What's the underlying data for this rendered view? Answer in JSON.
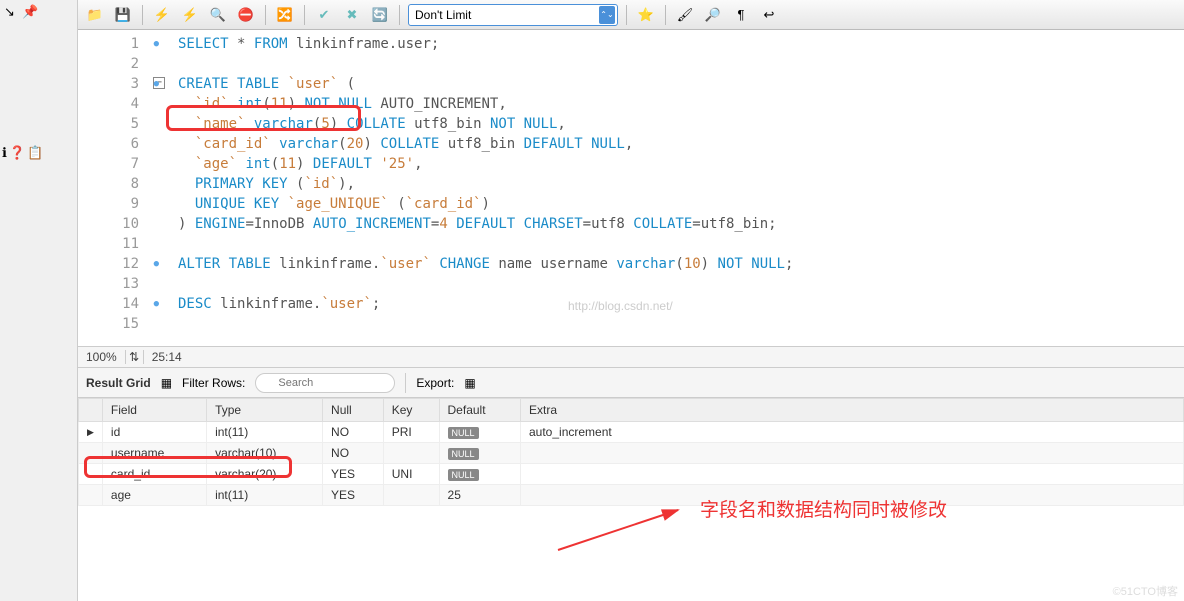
{
  "toolbar": {
    "limit_label": "Don't Limit"
  },
  "editor": {
    "lines": [
      "SELECT * FROM linkinframe.user;",
      "",
      "CREATE TABLE `user` (",
      "  `id` int(11) NOT NULL AUTO_INCREMENT,",
      "  `name` varchar(5) COLLATE utf8_bin NOT NULL,",
      "  `card_id` varchar(20) COLLATE utf8_bin DEFAULT NULL,",
      "  `age` int(11) DEFAULT '25',",
      "  PRIMARY KEY (`id`),",
      "  UNIQUE KEY `age_UNIQUE` (`card_id`)",
      ") ENGINE=InnoDB AUTO_INCREMENT=4 DEFAULT CHARSET=utf8 COLLATE=utf8_bin;",
      "",
      "ALTER TABLE linkinframe.`user` CHANGE name username varchar(10) NOT NULL;",
      "",
      "DESC linkinframe.`user`;",
      ""
    ],
    "watermark": "http://blog.csdn.net/"
  },
  "status": {
    "zoom": "100%",
    "cursor": "25:14"
  },
  "result_bar": {
    "grid_label": "Result Grid",
    "filter_label": "Filter Rows:",
    "search_placeholder": "Search",
    "export_label": "Export:"
  },
  "grid": {
    "columns": [
      "Field",
      "Type",
      "Null",
      "Key",
      "Default",
      "Extra"
    ],
    "rows": [
      {
        "Field": "id",
        "Type": "int(11)",
        "Null": "NO",
        "Key": "PRI",
        "Default": "NULL",
        "Extra": "auto_increment"
      },
      {
        "Field": "username",
        "Type": "varchar(10)",
        "Null": "NO",
        "Key": "",
        "Default": "NULL",
        "Extra": ""
      },
      {
        "Field": "card_id",
        "Type": "varchar(20)",
        "Null": "YES",
        "Key": "UNI",
        "Default": "NULL",
        "Extra": ""
      },
      {
        "Field": "age",
        "Type": "int(11)",
        "Null": "YES",
        "Key": "",
        "Default": "25",
        "Extra": ""
      }
    ]
  },
  "annotation": "字段名和数据结构同时被修改",
  "footer_watermark": "©51CTO博客"
}
